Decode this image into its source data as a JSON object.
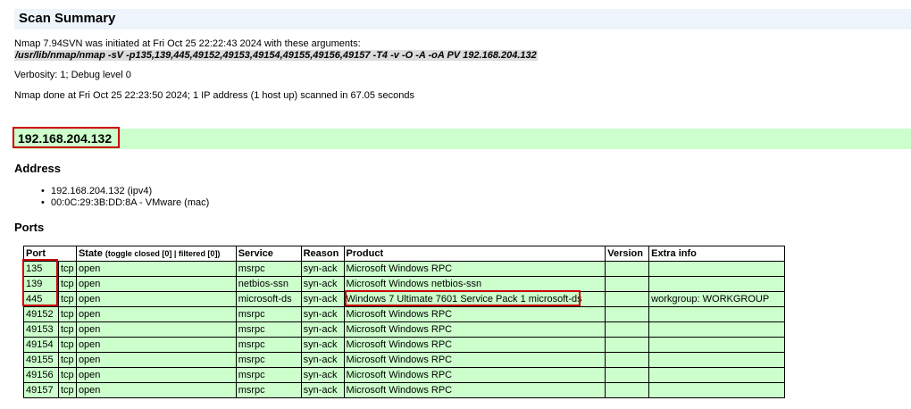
{
  "title": "Scan Summary",
  "summary": {
    "init_line": "Nmap 7.94SVN was initiated at Fri Oct 25 22:22:43 2024 with these arguments:",
    "command": "/usr/lib/nmap/nmap -sV -p135,139,445,49152,49153,49154,49155,49156,49157 -T4 -v -O -A -oA PV 192.168.204.132",
    "verbosity": "Verbosity: 1; Debug level 0",
    "done_line": "Nmap done at Fri Oct 25 22:23:50 2024; 1 IP address (1 host up) scanned in 67.05 seconds"
  },
  "host": {
    "ip": "192.168.204.132"
  },
  "address": {
    "heading": "Address",
    "items": [
      "192.168.204.132 (ipv4)",
      "00:0C:29:3B:DD:8A - VMware (mac)"
    ]
  },
  "ports": {
    "heading": "Ports",
    "columns": {
      "port": "Port",
      "state": "State",
      "state_toggle": "(toggle closed [0] | filtered [0])",
      "service": "Service",
      "reason": "Reason",
      "product": "Product",
      "version": "Version",
      "extra": "Extra info"
    },
    "rows": [
      {
        "port": "135",
        "proto": "tcp",
        "state": "open",
        "service": "msrpc",
        "reason": "syn-ack",
        "product": "Microsoft Windows RPC",
        "version": "",
        "extra": ""
      },
      {
        "port": "139",
        "proto": "tcp",
        "state": "open",
        "service": "netbios-ssn",
        "reason": "syn-ack",
        "product": "Microsoft Windows netbios-ssn",
        "version": "",
        "extra": ""
      },
      {
        "port": "445",
        "proto": "tcp",
        "state": "open",
        "service": "microsoft-ds",
        "reason": "syn-ack",
        "product": "Windows 7 Ultimate 7601 Service Pack 1 microsoft-ds",
        "version": "",
        "extra": "workgroup: WORKGROUP"
      },
      {
        "port": "49152",
        "proto": "tcp",
        "state": "open",
        "service": "msrpc",
        "reason": "syn-ack",
        "product": "Microsoft Windows RPC",
        "version": "",
        "extra": ""
      },
      {
        "port": "49153",
        "proto": "tcp",
        "state": "open",
        "service": "msrpc",
        "reason": "syn-ack",
        "product": "Microsoft Windows RPC",
        "version": "",
        "extra": ""
      },
      {
        "port": "49154",
        "proto": "tcp",
        "state": "open",
        "service": "msrpc",
        "reason": "syn-ack",
        "product": "Microsoft Windows RPC",
        "version": "",
        "extra": ""
      },
      {
        "port": "49155",
        "proto": "tcp",
        "state": "open",
        "service": "msrpc",
        "reason": "syn-ack",
        "product": "Microsoft Windows RPC",
        "version": "",
        "extra": ""
      },
      {
        "port": "49156",
        "proto": "tcp",
        "state": "open",
        "service": "msrpc",
        "reason": "syn-ack",
        "product": "Microsoft Windows RPC",
        "version": "",
        "extra": ""
      },
      {
        "port": "49157",
        "proto": "tcp",
        "state": "open",
        "service": "msrpc",
        "reason": "syn-ack",
        "product": "Microsoft Windows RPC",
        "version": "",
        "extra": ""
      }
    ]
  },
  "colors": {
    "title_bg": "#eef4fb",
    "host_bg": "#ccffcc",
    "row_bg": "#ccffcc",
    "highlight": "#cc0000"
  }
}
